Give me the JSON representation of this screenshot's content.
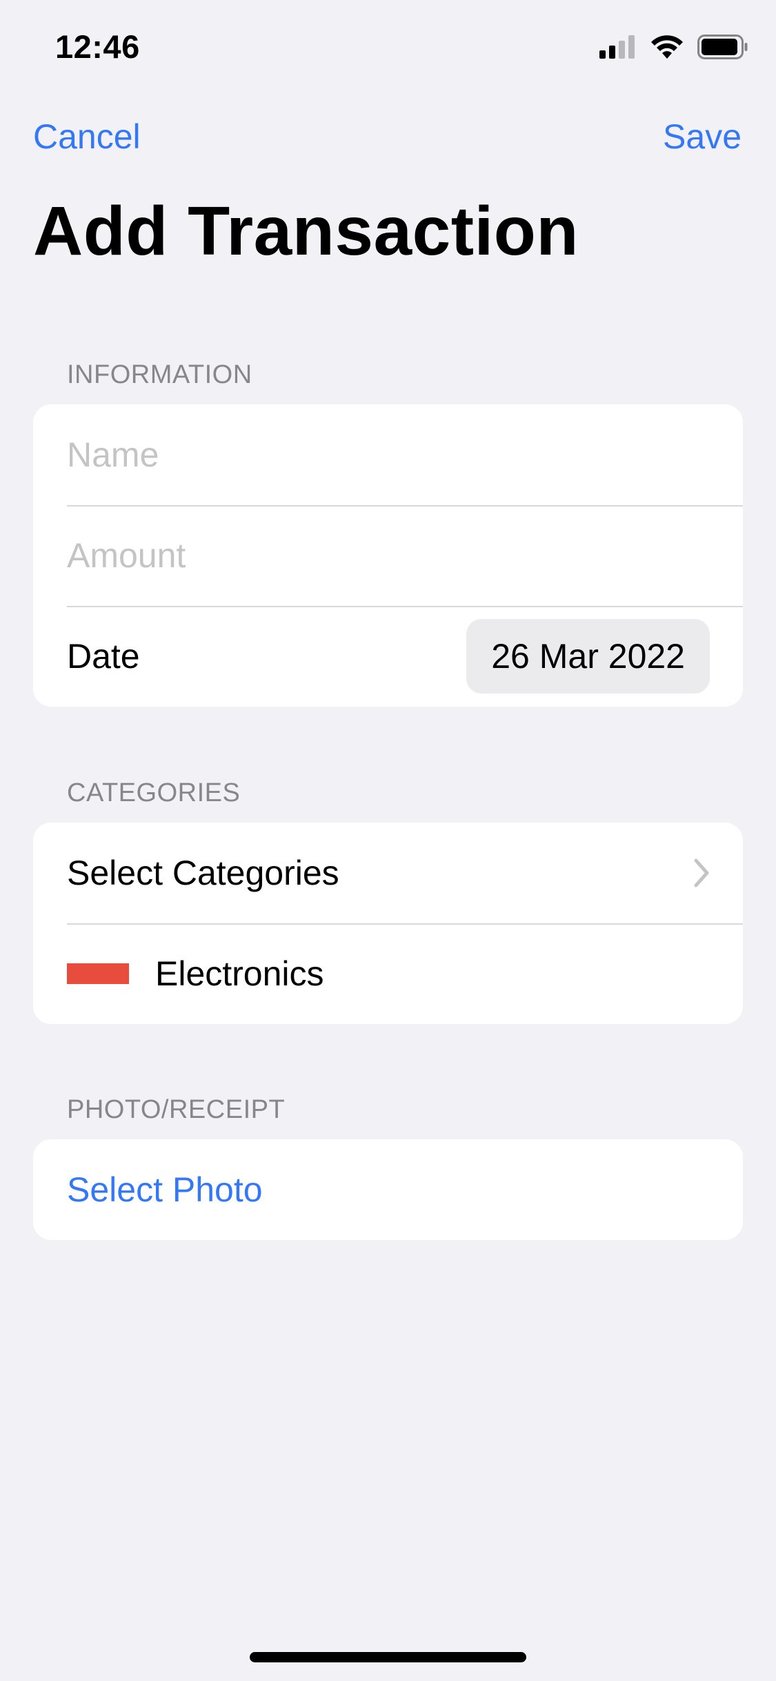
{
  "status_bar": {
    "time": "12:46"
  },
  "nav": {
    "cancel_label": "Cancel",
    "save_label": "Save"
  },
  "title": "Add Transaction",
  "sections": {
    "information": {
      "header": "INFORMATION",
      "name_placeholder": "Name",
      "name_value": "",
      "amount_placeholder": "Amount",
      "amount_value": "",
      "date_label": "Date",
      "date_value": "26 Mar 2022"
    },
    "categories": {
      "header": "CATEGORIES",
      "select_label": "Select Categories",
      "items": [
        {
          "label": "Electronics",
          "color": "#e84c3d"
        }
      ]
    },
    "photo": {
      "header": "PHOTO/RECEIPT",
      "select_label": "Select Photo"
    }
  },
  "colors": {
    "accent": "#3478f6",
    "background": "#f1f1f6"
  },
  "icons": {
    "signal": "cellular-signal-icon",
    "wifi": "wifi-icon",
    "battery": "battery-icon",
    "chevron": "chevron-right-icon"
  }
}
